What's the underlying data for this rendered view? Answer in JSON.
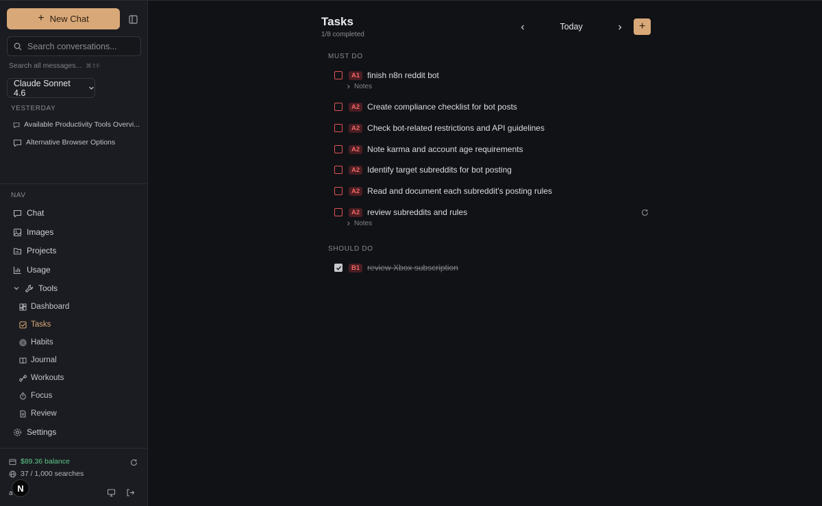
{
  "sidebar": {
    "new_chat_label": "New Chat",
    "search_placeholder": "Search conversations...",
    "search_all_label": "Search all messages...",
    "search_all_shortcut": "⌘⇧F",
    "model_label": "Claude Sonnet 4.6",
    "yesterday_label": "YESTERDAY",
    "conversations": [
      {
        "title": "Available Productivity Tools Overvi..."
      },
      {
        "title": "Alternative Browser Options"
      }
    ],
    "nav_label": "NAV",
    "nav": {
      "chat": "Chat",
      "images": "Images",
      "projects": "Projects",
      "usage": "Usage",
      "tools": "Tools",
      "settings": "Settings"
    },
    "tools": {
      "dashboard": "Dashboard",
      "tasks": "Tasks",
      "habits": "Habits",
      "journal": "Journal",
      "workouts": "Workouts",
      "focus": "Focus",
      "review": "Review"
    },
    "balance": "$89.36 balance",
    "searches": "37 / 1,000 searches",
    "user_initial": "a",
    "avatar_letter": "N"
  },
  "main": {
    "title": "Tasks",
    "progress": "1/8 completed",
    "date_label": "Today",
    "add_label": "+",
    "groups": {
      "must_do": {
        "label": "MUST DO",
        "tasks": [
          {
            "priority": "A1",
            "text": "finish n8n reddit bot",
            "notes": "Notes"
          },
          {
            "priority": "A2",
            "text": "Create compliance checklist for bot posts"
          },
          {
            "priority": "A2",
            "text": "Check bot-related restrictions and API guidelines"
          },
          {
            "priority": "A2",
            "text": "Note karma and account age requirements"
          },
          {
            "priority": "A2",
            "text": "Identify target subreddits for bot posting"
          },
          {
            "priority": "A2",
            "text": "Read and document each subreddit's posting rules"
          },
          {
            "priority": "A2",
            "text": "review subreddits and rules",
            "notes": "Notes"
          }
        ]
      },
      "should_do": {
        "label": "SHOULD DO",
        "tasks": [
          {
            "priority": "B1",
            "text": "review Xbox subscription",
            "done": true
          }
        ]
      }
    }
  }
}
